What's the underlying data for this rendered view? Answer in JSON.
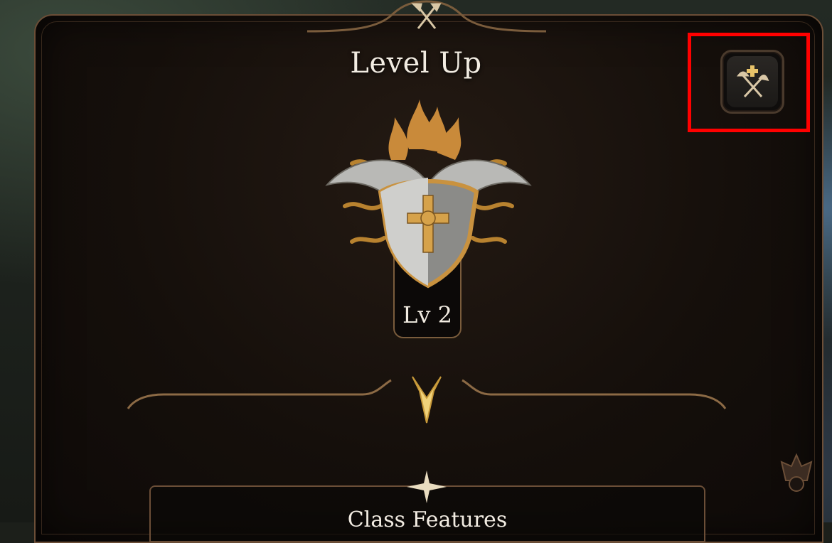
{
  "window": {
    "title": "Level Up"
  },
  "toggle_button": {
    "icon": "axes-plus-icon",
    "highlighted": true,
    "highlight_color": "#ff0000"
  },
  "character": {
    "level_label": "Lv 2",
    "emblem_icon": "winged-shield-crest-icon"
  },
  "sections": [
    {
      "title": "Class Features"
    }
  ],
  "colors": {
    "accent_gold": "#e8c36a",
    "frame_bronze": "#7a5c3c",
    "text": "#f2ece2"
  }
}
